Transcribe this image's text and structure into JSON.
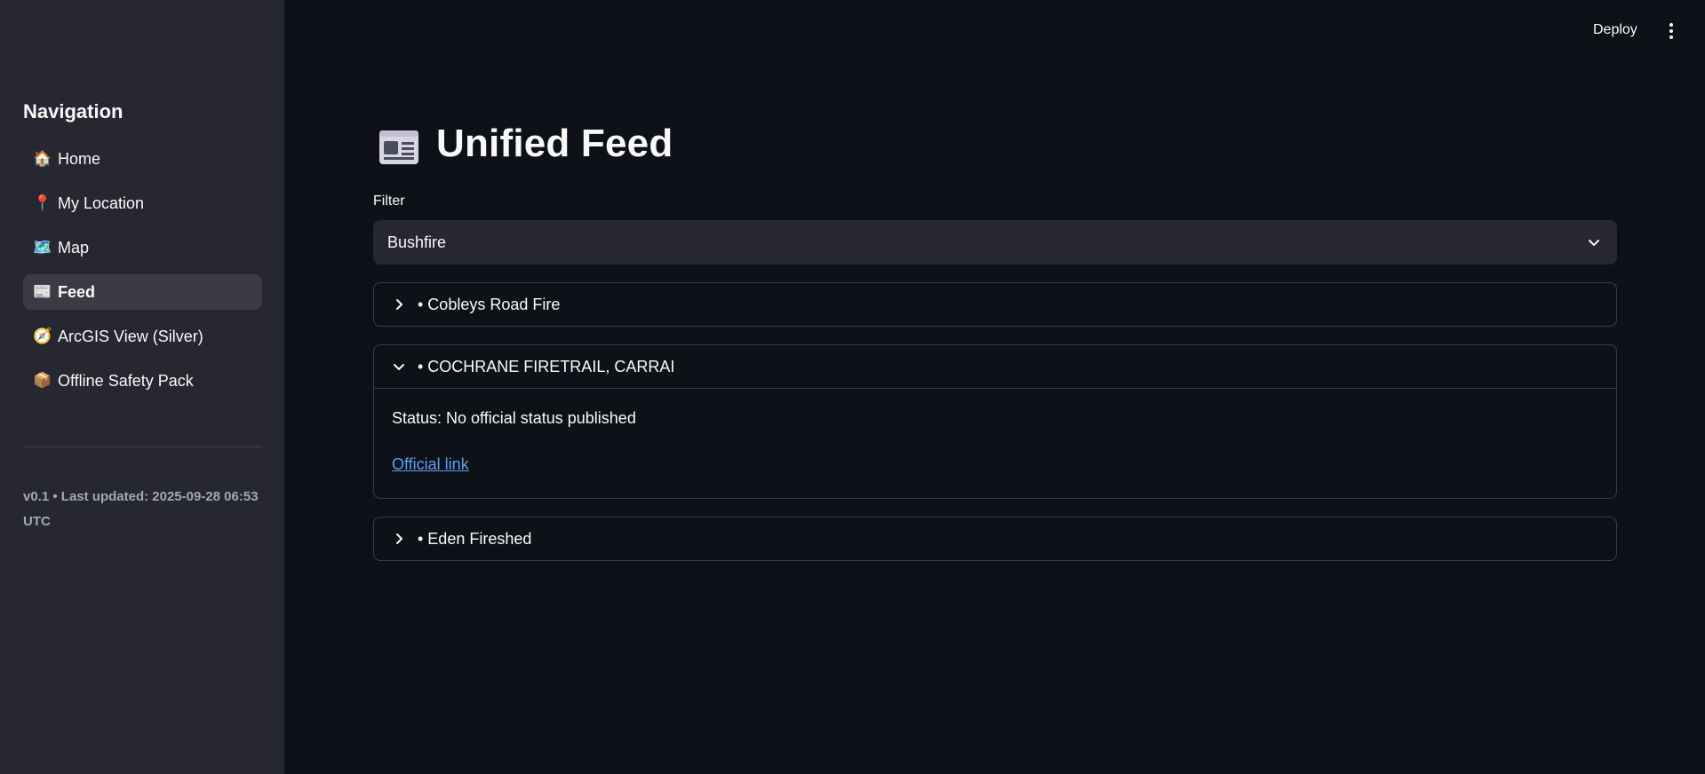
{
  "sidebar": {
    "title": "Navigation",
    "items": [
      {
        "icon": "🏠",
        "icon_name": "house-icon",
        "label": "Home",
        "active": false
      },
      {
        "icon": "📍",
        "icon_name": "pin-icon",
        "label": "My Location",
        "active": false
      },
      {
        "icon": "🗺️",
        "icon_name": "map-icon",
        "label": "Map",
        "active": false
      },
      {
        "icon": "📰",
        "icon_name": "newspaper-icon",
        "label": "Feed",
        "active": true
      },
      {
        "icon": "🧭",
        "icon_name": "compass-icon",
        "label": "ArcGIS View (Silver)",
        "active": false
      },
      {
        "icon": "📦",
        "icon_name": "package-icon",
        "label": "Offline Safety Pack",
        "active": false
      }
    ],
    "version_text": "v0.1 • Last updated: 2025-09-28 06:53 UTC"
  },
  "header": {
    "deploy_label": "Deploy",
    "menu_icon": "kebab-menu-icon"
  },
  "main": {
    "page_icon": "newspaper-icon",
    "title": "Unified Feed",
    "filter": {
      "label": "Filter",
      "value": "Bushfire"
    },
    "incidents": [
      {
        "title": "• Cobleys Road Fire",
        "expanded": false
      },
      {
        "title": "• COCHRANE FIRETRAIL, CARRAI",
        "expanded": true,
        "status": "Status: No official status published",
        "link_text": "Official link"
      },
      {
        "title": "• Eden Fireshed",
        "expanded": false
      }
    ]
  },
  "colors": {
    "background": "#0e1117",
    "sidebar": "#262730",
    "active_item": "#3a3b45",
    "link": "#5aa0f2",
    "border": "#3b3d48"
  }
}
